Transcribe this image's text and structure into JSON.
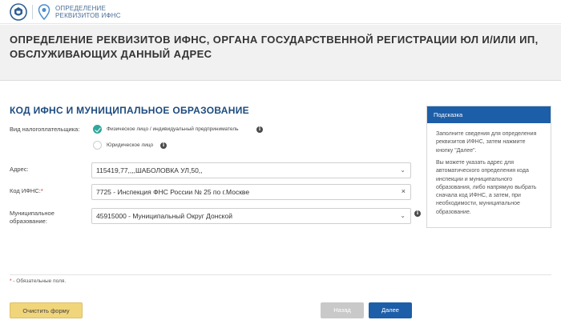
{
  "header": {
    "logo_line1": "ОПРЕДЕЛЕНИЕ",
    "logo_line2": "РЕКВИЗИТОВ ИФНС"
  },
  "page": {
    "title": "ОПРЕДЕЛЕНИЕ РЕКВИЗИТОВ ИФНС, ОРГАНА ГОСУДАРСТВЕННОЙ РЕГИСТРАЦИИ ЮЛ И/ИЛИ ИП, ОБСЛУЖИВАЮЩИХ ДАННЫЙ АДРЕС"
  },
  "section": {
    "title": "КОД ИФНС И МУНИЦИПАЛЬНОЕ ОБРАЗОВАНИЕ"
  },
  "form": {
    "taxpayer_label": "Вид налогоплательщика:",
    "taxpayer_options": [
      {
        "label": "Физическое лицо / индивидуальный предприниматель",
        "selected": true
      },
      {
        "label": "Юридическое лицо",
        "selected": false
      }
    ],
    "address_label": "Адрес:",
    "address_value": "115419,77,,,,ШАБОЛОВКА УЛ,50,,",
    "ifns_label": "Код ИФНС:",
    "ifns_required_mark": "*",
    "ifns_value": "7725 - Инспекция ФНС России № 25 по г.Москве",
    "municipal_label_line1": "Муниципальное",
    "municipal_label_line2": "образование:",
    "municipal_value": "45915000 - Муниципальный Округ Донской",
    "info_glyph": "i",
    "caret_glyph": "⌄",
    "clear_glyph": "×"
  },
  "hint": {
    "title": "Подсказка",
    "para1": "Заполните сведения для определения реквизитов ИФНС, затем нажмите кнопку \"Далее\".",
    "para2": "Вы можете указать адрес для автоматического определения кода инспекции и муниципального образования, либо напрямую выбрать сначала код ИФНС, а затем, при необходимости, муниципальное образование."
  },
  "footer": {
    "required_star": "*",
    "required_note": " - Обязательные поля.",
    "clear_button": "Очистить форму",
    "back_button": "Назад",
    "next_button": "Далее"
  },
  "colors": {
    "accent_blue": "#1d5ea8",
    "heading_blue": "#1d4b7e",
    "radio_checked": "#2fa89c",
    "clear_button": "#f1d57a",
    "disabled_button": "#c9c9c9"
  },
  "icons": {
    "emblem": "fns-emblem-icon",
    "pin": "location-pin-icon",
    "info": "info-icon",
    "caret": "chevron-down-icon",
    "clear": "close-icon"
  }
}
